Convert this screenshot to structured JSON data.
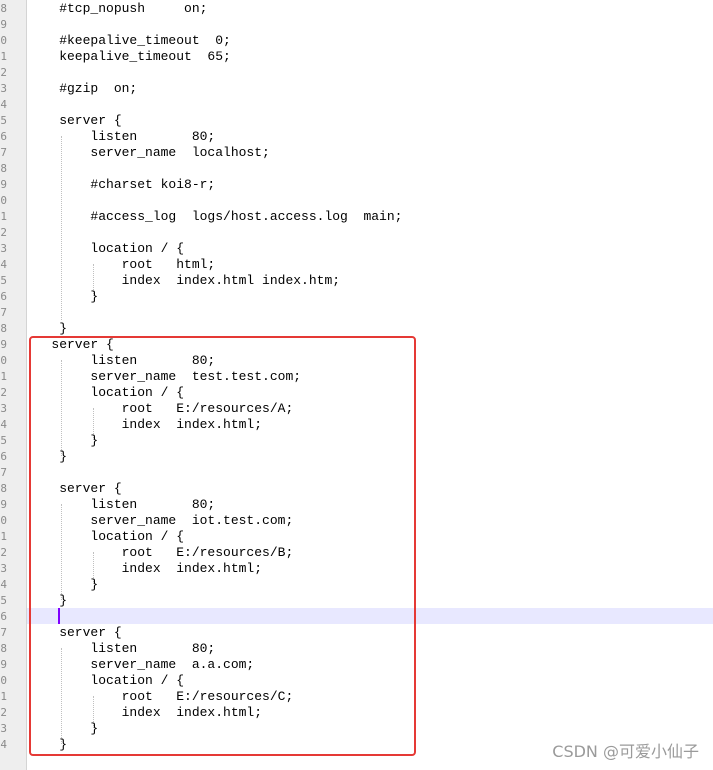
{
  "editor": {
    "lines": [
      {
        "num": "8",
        "text": "    #tcp_nopush     on;"
      },
      {
        "num": "9",
        "text": ""
      },
      {
        "num": "0",
        "text": "    #keepalive_timeout  0;"
      },
      {
        "num": "1",
        "text": "    keepalive_timeout  65;"
      },
      {
        "num": "2",
        "text": ""
      },
      {
        "num": "3",
        "text": "    #gzip  on;"
      },
      {
        "num": "4",
        "text": ""
      },
      {
        "num": "5",
        "text": "    server {"
      },
      {
        "num": "6",
        "text": "        listen       80;"
      },
      {
        "num": "7",
        "text": "        server_name  localhost;"
      },
      {
        "num": "8",
        "text": ""
      },
      {
        "num": "9",
        "text": "        #charset koi8-r;"
      },
      {
        "num": "0",
        "text": ""
      },
      {
        "num": "1",
        "text": "        #access_log  logs/host.access.log  main;"
      },
      {
        "num": "2",
        "text": ""
      },
      {
        "num": "3",
        "text": "        location / {"
      },
      {
        "num": "4",
        "text": "            root   html;"
      },
      {
        "num": "5",
        "text": "            index  index.html index.htm;"
      },
      {
        "num": "6",
        "text": "        }"
      },
      {
        "num": "7",
        "text": ""
      },
      {
        "num": "8",
        "text": "    }"
      },
      {
        "num": "9",
        "text": "   server {"
      },
      {
        "num": "0",
        "text": "        listen       80;"
      },
      {
        "num": "1",
        "text": "        server_name  test.test.com;"
      },
      {
        "num": "2",
        "text": "        location / {"
      },
      {
        "num": "3",
        "text": "            root   E:/resources/A;"
      },
      {
        "num": "4",
        "text": "            index  index.html;"
      },
      {
        "num": "5",
        "text": "        }"
      },
      {
        "num": "6",
        "text": "    }"
      },
      {
        "num": "7",
        "text": ""
      },
      {
        "num": "8",
        "text": "    server {"
      },
      {
        "num": "9",
        "text": "        listen       80;"
      },
      {
        "num": "0",
        "text": "        server_name  iot.test.com;"
      },
      {
        "num": "1",
        "text": "        location / {"
      },
      {
        "num": "2",
        "text": "            root   E:/resources/B;"
      },
      {
        "num": "3",
        "text": "            index  index.html;"
      },
      {
        "num": "4",
        "text": "        }"
      },
      {
        "num": "5",
        "text": "    }"
      },
      {
        "num": "6",
        "text": ""
      },
      {
        "num": "7",
        "text": "    server {"
      },
      {
        "num": "8",
        "text": "        listen       80;"
      },
      {
        "num": "9",
        "text": "        server_name  a.a.com;"
      },
      {
        "num": "0",
        "text": "        location / {"
      },
      {
        "num": "1",
        "text": "            root   E:/resources/C;"
      },
      {
        "num": "2",
        "text": "            index  index.html;"
      },
      {
        "num": "3",
        "text": "        }"
      },
      {
        "num": "4",
        "text": "    }"
      }
    ],
    "current_line_index": 38
  },
  "watermark": {
    "text": "CSDN @可爱小仙子"
  },
  "colors": {
    "highlight_border": "#e53935",
    "current_line": "#e8e8ff",
    "caret": "#8000ff",
    "gutter": "#eeeeee"
  }
}
